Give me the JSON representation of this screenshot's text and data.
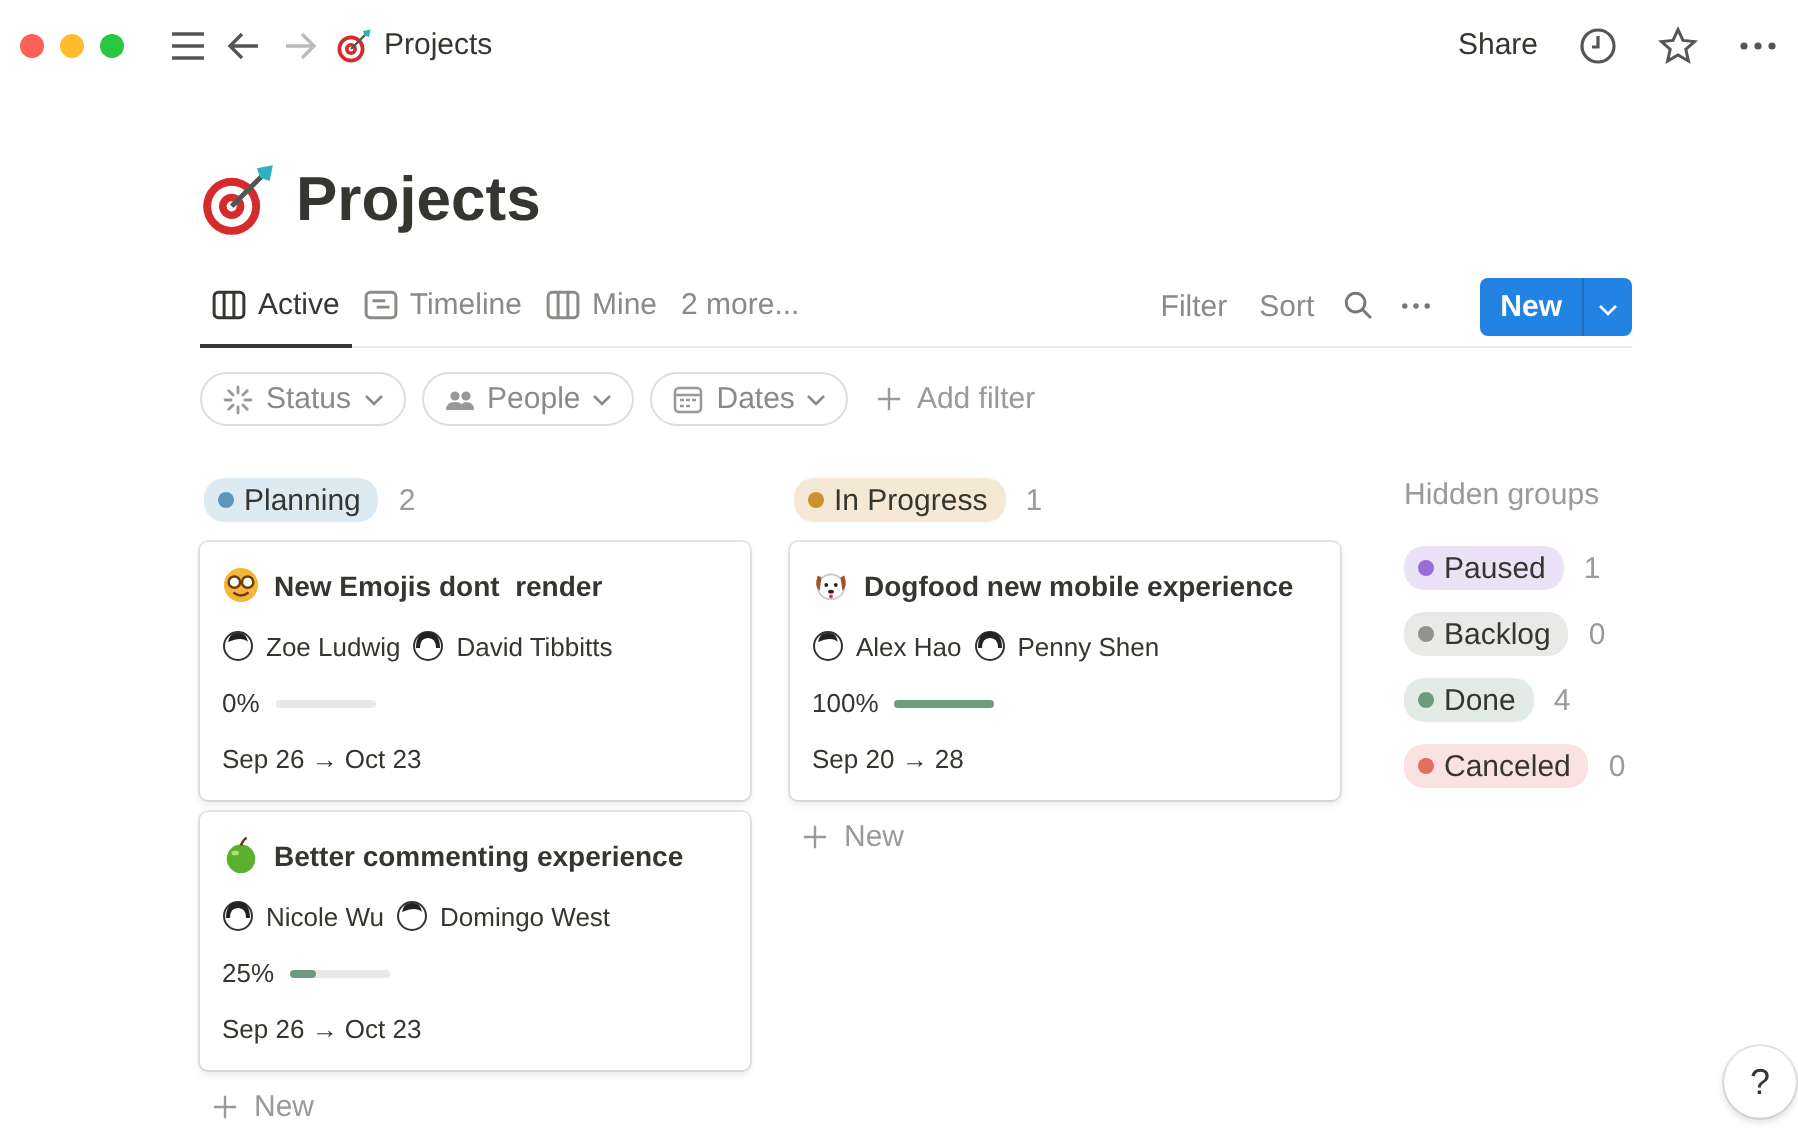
{
  "topbar": {
    "breadcrumb": "Projects",
    "share": "Share"
  },
  "page": {
    "title": "Projects"
  },
  "tabs": [
    {
      "label": "Active",
      "kind": "board",
      "selected": true
    },
    {
      "label": "Timeline",
      "kind": "timeline",
      "selected": false
    },
    {
      "label": "Mine",
      "kind": "board",
      "selected": false
    },
    {
      "label": "2 more...",
      "kind": "more",
      "selected": false
    }
  ],
  "toolbar": {
    "filter": "Filter",
    "sort": "Sort",
    "new_button": "New"
  },
  "filters": [
    {
      "label": "Status",
      "kind": "status"
    },
    {
      "label": "People",
      "kind": "people"
    },
    {
      "label": "Dates",
      "kind": "dates"
    }
  ],
  "add_filter": "Add filter",
  "groups": [
    {
      "name": "Planning",
      "color": "#5b97bd",
      "count": "2",
      "new_label": "New",
      "cards": [
        {
          "title": "New Emojis dont  render",
          "people": [
            "Zoe Ludwig",
            "David Tibbitts"
          ],
          "progress": "0%",
          "dates": "Sep 26 → Oct 23"
        },
        {
          "title": "Better commenting experience",
          "people": [
            "Nicole Wu",
            "Domingo West"
          ],
          "progress": "25%",
          "level": 0.25,
          "dates": "Sep 26 → Oct 23"
        }
      ]
    },
    {
      "name": "In Progress",
      "color": "#cb912f",
      "count": "1",
      "new_label": "New",
      "cards": [
        {
          "title": "Dogfood new mobile experience",
          "people": [
            "Alex Hao",
            "Penny Shen"
          ],
          "progress": "100%",
          "level": 1,
          "dates": "Sep 20 → 28"
        }
      ]
    }
  ],
  "hidden_groups": {
    "title": "Hidden groups",
    "items": [
      {
        "name": "Paused",
        "color": "#9a6dd7",
        "count": "1"
      },
      {
        "name": "Backlog",
        "color": "#91918e",
        "count": "0"
      },
      {
        "name": "Done",
        "color": "#6c9b7d",
        "count": "4"
      },
      {
        "name": "Canceled",
        "color": "#e16f64",
        "count": "0"
      }
    ]
  },
  "help": "?"
}
